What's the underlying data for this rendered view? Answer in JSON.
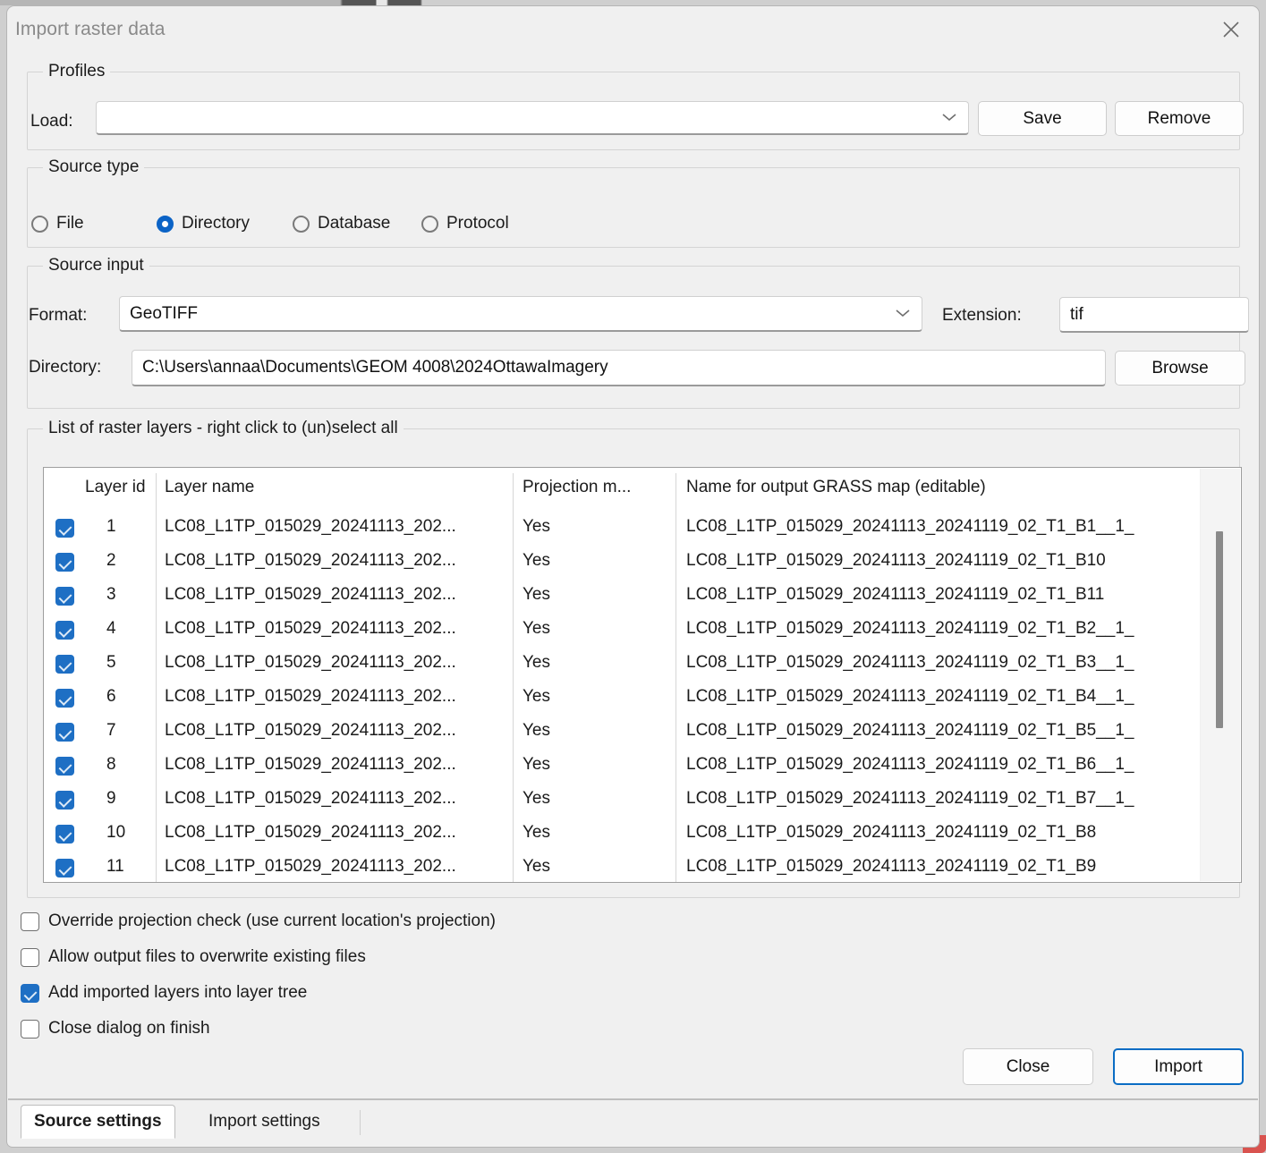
{
  "window": {
    "title": "Import raster data",
    "close_icon": "close-icon"
  },
  "profiles": {
    "group_title": "Profiles",
    "load_label": "Load:",
    "load_value": "",
    "load_placeholder": "",
    "save_label": "Save",
    "remove_label": "Remove",
    "caret_icon": "chevron-down-icon"
  },
  "source_type": {
    "group_title": "Source type",
    "options": [
      {
        "label": "File",
        "selected": false
      },
      {
        "label": "Directory",
        "selected": true
      },
      {
        "label": "Database",
        "selected": false
      },
      {
        "label": "Protocol",
        "selected": false
      }
    ]
  },
  "source_input": {
    "group_title": "Source input",
    "format_label": "Format:",
    "format_value": "GeoTIFF",
    "extension_label": "Extension:",
    "extension_value": "tif",
    "directory_label": "Directory:",
    "directory_value": "C:\\Users\\annaa\\Documents\\GEOM 4008\\2024OttawaImagery",
    "browse_label": "Browse"
  },
  "layer_list": {
    "group_title": "List of raster layers - right click to (un)select all",
    "columns": [
      "Layer id",
      "Layer name",
      "Projection m...",
      "Name for output GRASS map (editable)"
    ],
    "rows": [
      {
        "checked": true,
        "id": "1",
        "name": "LC08_L1TP_015029_20241113_202...",
        "projection": "Yes",
        "output": "LC08_L1TP_015029_20241113_20241119_02_T1_B1__1_"
      },
      {
        "checked": true,
        "id": "2",
        "name": "LC08_L1TP_015029_20241113_202...",
        "projection": "Yes",
        "output": "LC08_L1TP_015029_20241113_20241119_02_T1_B10"
      },
      {
        "checked": true,
        "id": "3",
        "name": "LC08_L1TP_015029_20241113_202...",
        "projection": "Yes",
        "output": "LC08_L1TP_015029_20241113_20241119_02_T1_B11"
      },
      {
        "checked": true,
        "id": "4",
        "name": "LC08_L1TP_015029_20241113_202...",
        "projection": "Yes",
        "output": "LC08_L1TP_015029_20241113_20241119_02_T1_B2__1_"
      },
      {
        "checked": true,
        "id": "5",
        "name": "LC08_L1TP_015029_20241113_202...",
        "projection": "Yes",
        "output": "LC08_L1TP_015029_20241113_20241119_02_T1_B3__1_"
      },
      {
        "checked": true,
        "id": "6",
        "name": "LC08_L1TP_015029_20241113_202...",
        "projection": "Yes",
        "output": "LC08_L1TP_015029_20241113_20241119_02_T1_B4__1_"
      },
      {
        "checked": true,
        "id": "7",
        "name": "LC08_L1TP_015029_20241113_202...",
        "projection": "Yes",
        "output": "LC08_L1TP_015029_20241113_20241119_02_T1_B5__1_"
      },
      {
        "checked": true,
        "id": "8",
        "name": "LC08_L1TP_015029_20241113_202...",
        "projection": "Yes",
        "output": "LC08_L1TP_015029_20241113_20241119_02_T1_B6__1_"
      },
      {
        "checked": true,
        "id": "9",
        "name": "LC08_L1TP_015029_20241113_202...",
        "projection": "Yes",
        "output": "LC08_L1TP_015029_20241113_20241119_02_T1_B7__1_"
      },
      {
        "checked": true,
        "id": "10",
        "name": "LC08_L1TP_015029_20241113_202...",
        "projection": "Yes",
        "output": "LC08_L1TP_015029_20241113_20241119_02_T1_B8"
      },
      {
        "checked": true,
        "id": "11",
        "name": "LC08_L1TP_015029_20241113_202...",
        "projection": "Yes",
        "output": "LC08_L1TP_015029_20241113_20241119_02_T1_B9"
      }
    ]
  },
  "options": [
    {
      "label": "Override projection check (use current location's projection)",
      "checked": false
    },
    {
      "label": "Allow output files to overwrite existing files",
      "checked": false
    },
    {
      "label": "Add imported layers into layer tree",
      "checked": true
    },
    {
      "label": "Close dialog on finish",
      "checked": false
    }
  ],
  "footer": {
    "close_label": "Close",
    "import_label": "Import"
  },
  "tabs": [
    {
      "label": "Source settings",
      "active": true
    },
    {
      "label": "Import settings",
      "active": false
    }
  ],
  "colors": {
    "accent": "#1e6fc4",
    "radio_selected": "#0b63c6",
    "focus_border": "#0a6cc4",
    "dialog_bg": "#f0f0f0",
    "field_bg": "#ffffff"
  }
}
